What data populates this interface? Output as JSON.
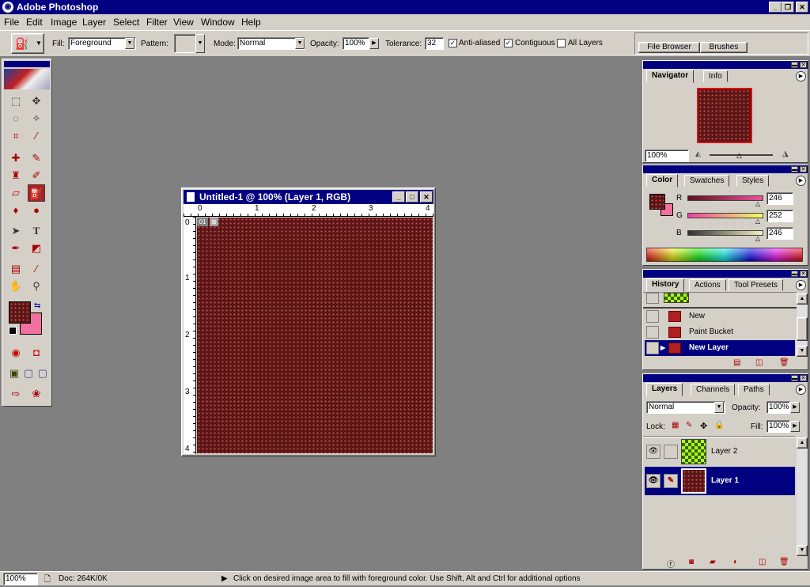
{
  "app": {
    "title": "Adobe Photoshop",
    "min": "_",
    "restore": "❐",
    "close": "✕"
  },
  "menu": [
    "File",
    "Edit",
    "Image",
    "Layer",
    "Select",
    "Filter",
    "View",
    "Window",
    "Help"
  ],
  "options": {
    "fill_label": "Fill:",
    "fill_value": "Foreground",
    "pattern_label": "Pattern:",
    "mode_label": "Mode:",
    "mode_value": "Normal",
    "opacity_label": "Opacity:",
    "opacity_value": "100%",
    "tolerance_label": "Tolerance:",
    "tolerance_value": "32",
    "antialiased_label": "Anti-aliased",
    "antialiased_checked": true,
    "contiguous_label": "Contiguous",
    "contiguous_checked": true,
    "alllayers_label": "All Layers",
    "alllayers_checked": false,
    "well_tabs": [
      "File Browser",
      "Brushes"
    ]
  },
  "document": {
    "title": "Untitled-1 @ 100% (Layer 1, RGB)",
    "ruler_h": [
      "0",
      "1",
      "2",
      "3",
      "4"
    ],
    "ruler_v": [
      "0",
      "1",
      "2",
      "3",
      "4"
    ],
    "slice_label": "01"
  },
  "navigator": {
    "tabs": [
      "Navigator",
      "Info"
    ],
    "zoom": "100%"
  },
  "color": {
    "tabs": [
      "Color",
      "Swatches",
      "Styles"
    ],
    "r_label": "R",
    "r": "246",
    "g_label": "G",
    "g": "252",
    "b_label": "B",
    "b": "246"
  },
  "history": {
    "tabs": [
      "History",
      "Actions",
      "Tool Presets"
    ],
    "items": [
      "New",
      "Paint Bucket",
      "New Layer"
    ],
    "selected_index": 2
  },
  "layers": {
    "tabs": [
      "Layers",
      "Channels",
      "Paths"
    ],
    "blend": "Normal",
    "opacity_label": "Opacity:",
    "opacity": "100%",
    "lock_label": "Lock:",
    "fill_label": "Fill:",
    "fill": "100%",
    "items": [
      {
        "name": "Layer 2",
        "selected": false
      },
      {
        "name": "Layer 1",
        "selected": true
      }
    ]
  },
  "status": {
    "zoom": "100%",
    "doc": "Doc: 264K/0K",
    "message": "Click on desired image area to fill with foreground color.  Use Shift, Alt and Ctrl for additional options"
  },
  "colors": {
    "title_bar": "#000080",
    "chrome": "#d4d0c8",
    "workspace": "#808080",
    "foreground": "#5a1515",
    "background": "#f070a0"
  }
}
